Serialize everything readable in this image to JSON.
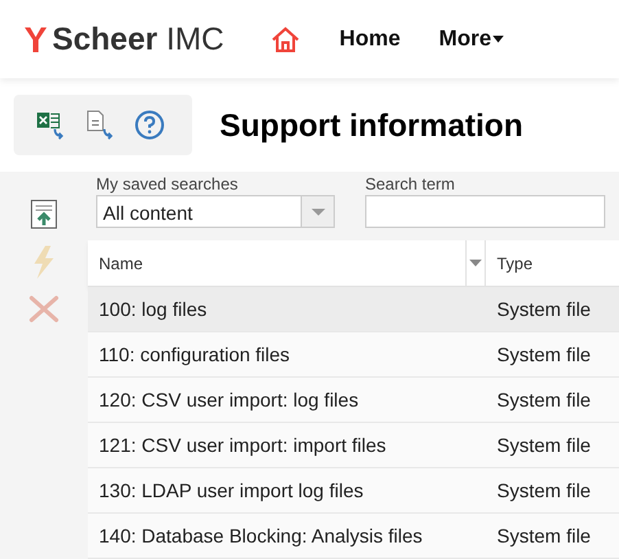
{
  "brand": {
    "name": "Scheer",
    "suffix": "IMC"
  },
  "nav": [
    {
      "kind": "home-icon"
    },
    {
      "kind": "link",
      "label": "Home"
    },
    {
      "kind": "dropdown",
      "label": "More"
    }
  ],
  "toolbar": [
    {
      "kind": "excel"
    },
    {
      "kind": "text"
    },
    {
      "kind": "help"
    }
  ],
  "title": "Support information",
  "side_actions": [
    {
      "kind": "export",
      "disabled": false
    },
    {
      "kind": "run",
      "disabled": true
    },
    {
      "kind": "delete",
      "disabled": true
    }
  ],
  "filters": {
    "saved_label": "My saved searches",
    "saved_value": "All content",
    "term_label": "Search term"
  },
  "table": {
    "columns": [
      "Name",
      "Type"
    ],
    "rows": [
      {
        "name": "100: log files",
        "type": "System file",
        "selected": true
      },
      {
        "name": "110: configuration files",
        "type": "System file",
        "selected": false
      },
      {
        "name": "120: CSV user import: log files",
        "type": "System file",
        "selected": false
      },
      {
        "name": "121: CSV user import: import files",
        "type": "System file",
        "selected": false
      },
      {
        "name": "130: LDAP user import log files",
        "type": "System file",
        "selected": false
      },
      {
        "name": "140: Database Blocking: Analysis files",
        "type": "System file",
        "selected": false
      }
    ]
  }
}
